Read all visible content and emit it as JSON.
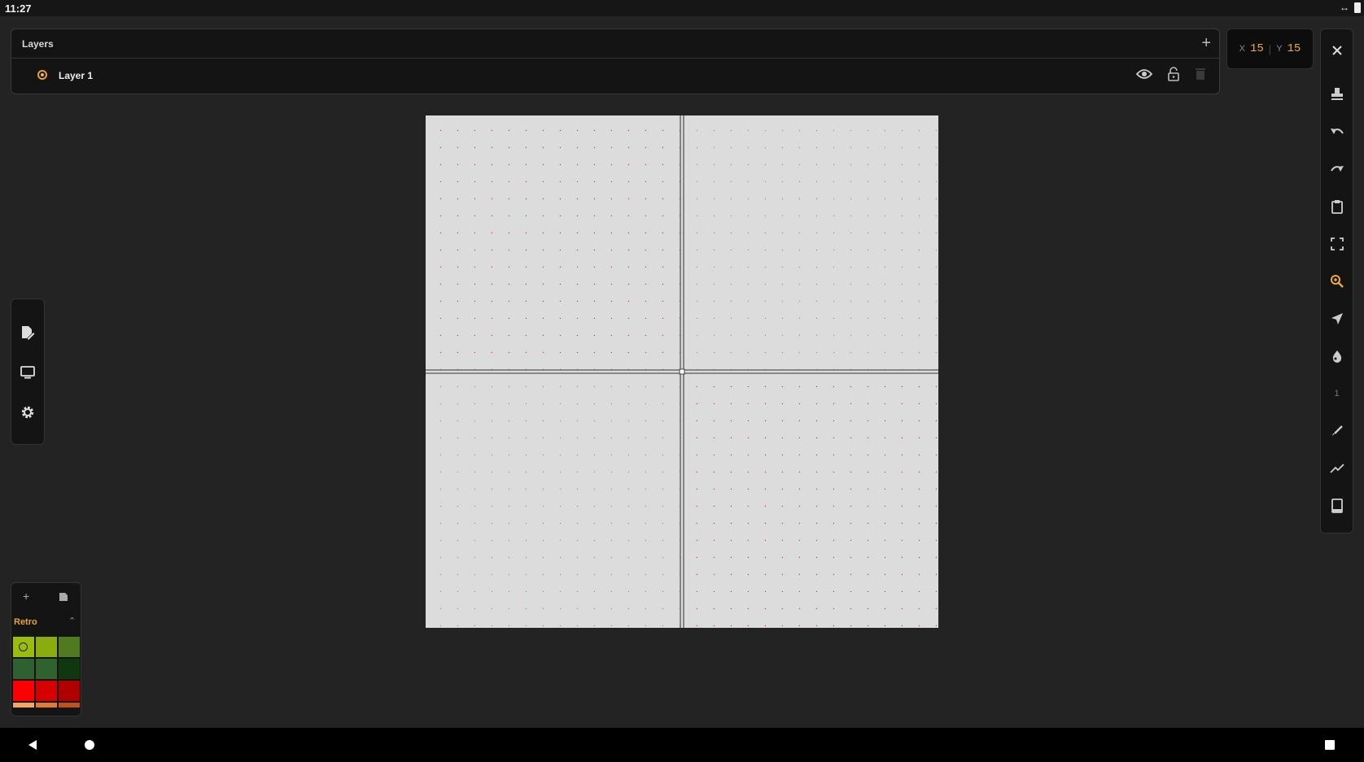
{
  "status_bar": {
    "time": "11:27"
  },
  "layers_panel": {
    "title": "Layers",
    "add_icon": "plus-icon",
    "layers": [
      {
        "name": "Layer 1",
        "active": true,
        "visible": true,
        "locked": false
      }
    ]
  },
  "cursor_position": {
    "x_label": "X",
    "x_value": "15",
    "y_label": "Y",
    "y_value": "15"
  },
  "right_toolbar": {
    "tools": [
      "close-icon",
      "stamp-icon",
      "undo-icon",
      "redo-icon",
      "clipboard-icon",
      "fullscreen-icon",
      "zoom-icon",
      "send-icon",
      "drop-icon",
      "brush-size",
      "pen-icon",
      "line-icon",
      "tablet-icon"
    ],
    "active_tool": "zoom-icon",
    "brush_size_value": "1"
  },
  "left_toolbar": {
    "tools": [
      "edit-document-icon",
      "monitor-icon",
      "settings-icon"
    ]
  },
  "palette": {
    "name": "Retro",
    "add_label": "+",
    "colors": [
      "#9bbc0f",
      "#8bac0f",
      "#4f7a22",
      "#2f6130",
      "#306230",
      "#0f380f",
      "#ff0000",
      "#d60000",
      "#b00000",
      "#f4a66a",
      "#e07a3a",
      "#c05020"
    ],
    "selected_index": 0
  },
  "canvas": {
    "grid_columns": 30,
    "grid_rows": 30,
    "quadrant_colors": {
      "top_left": "#d43a3a",
      "top_right": "#3ab4d4",
      "bottom_left": "#3ab4d4",
      "bottom_right": "#d43a3a"
    }
  },
  "accent_color": "#f0a93b"
}
